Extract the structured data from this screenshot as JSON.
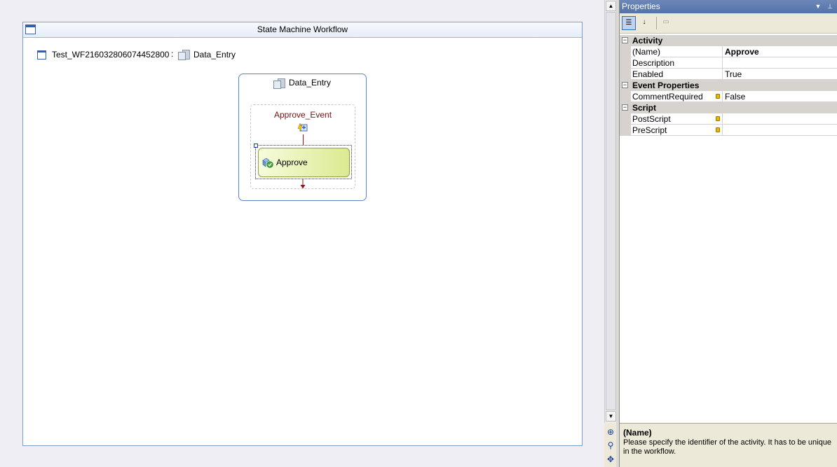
{
  "designer": {
    "workflow_title": "State Machine Workflow",
    "breadcrumb": {
      "workflow_name": "Test_WF216032806074452800",
      "separator": ":",
      "state_name": "Data_Entry"
    },
    "state": {
      "title": "Data_Entry",
      "event": {
        "title": "Approve_Event",
        "activity_label": "Approve"
      }
    }
  },
  "properties": {
    "title": "Properties",
    "toolbar": {
      "categorized_icon": "categorized-icon",
      "alphabetical_icon": "alphabetical-icon",
      "property_pages_icon": "property-pages-icon"
    },
    "categories": [
      {
        "name": "Activity",
        "toggle": "⊟",
        "rows": [
          {
            "name": "(Name)",
            "value": "Approve",
            "bold": true,
            "locked": false
          },
          {
            "name": "Description",
            "value": "",
            "bold": false,
            "locked": false
          },
          {
            "name": "Enabled",
            "value": "True",
            "bold": false,
            "locked": false
          }
        ]
      },
      {
        "name": "Event Properties",
        "toggle": "⊟",
        "rows": [
          {
            "name": "CommentRequired",
            "value": "False",
            "bold": false,
            "locked": true
          }
        ]
      },
      {
        "name": "Script",
        "toggle": "⊟",
        "rows": [
          {
            "name": "PostScript",
            "value": "",
            "bold": false,
            "locked": true
          },
          {
            "name": "PreScript",
            "value": "",
            "bold": false,
            "locked": true
          }
        ]
      }
    ],
    "description": {
      "title": "(Name)",
      "text": "Please specify the identifier of the activity. It has to be unique in the workflow."
    }
  },
  "colors": {
    "event_title": "#7a1010",
    "connector": "#8b1a1a",
    "activity_fill": "#dbea91",
    "title_bar": "#5b7ab0"
  }
}
